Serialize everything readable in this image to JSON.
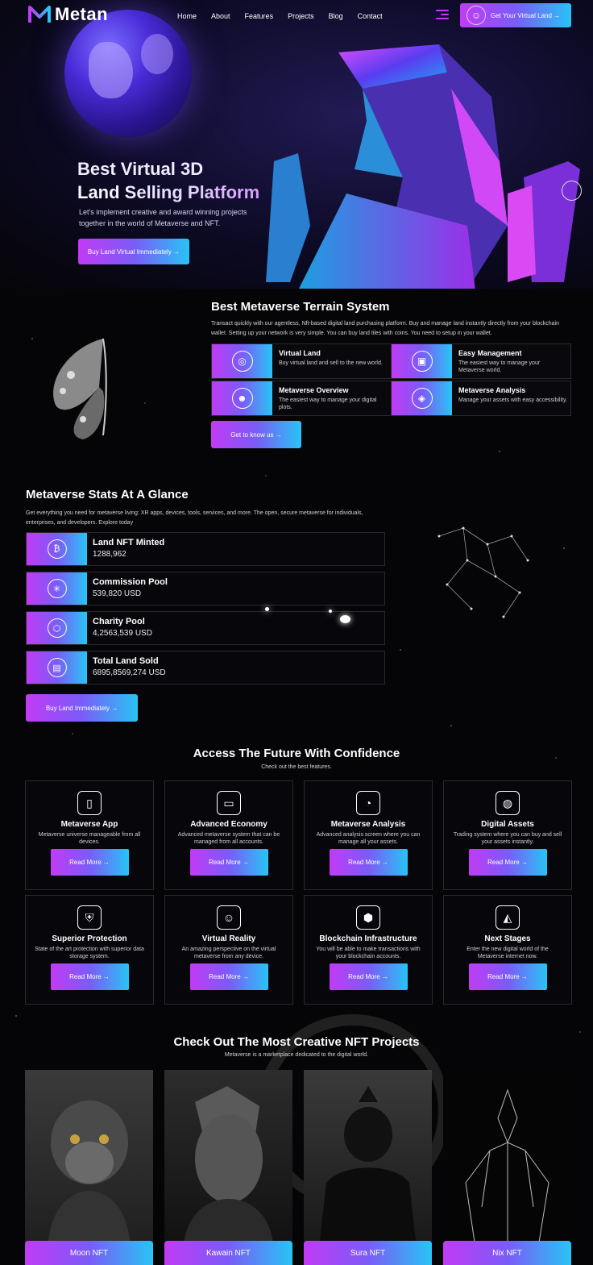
{
  "header": {
    "logo_text": "Metan",
    "nav": [
      "Home",
      "About",
      "Features",
      "Projects",
      "Blog",
      "Contact"
    ],
    "cta_label": "Get Your Virtual Land →"
  },
  "hero": {
    "title_line1": "Best Virtual 3D",
    "title_line2": "Land Selling Platform",
    "subtitle": "Let's implement creative and award winning projects together in the world of Metaverse and NFT.",
    "button_label": "Buy Land Virtual Immediately →"
  },
  "terrain": {
    "title": "Best Metaverse Terrain System",
    "description": "Transact quickly with our agentless, Nft-based digital land purchasing platform. Buy and manage land instantly directly from your blockchain wallet. Setting up your network is very simple. You can buy land tiles with coins. You need to setup in your wallet.",
    "features": [
      {
        "title": "Virtual Land",
        "desc": "Buy virtual land and sell to the new world.",
        "icon": "vr-headset-icon"
      },
      {
        "title": "Easy Management",
        "desc": "The easiest way to manage your Metaverse world.",
        "icon": "dashboard-icon"
      },
      {
        "title": "Metaverse Overview",
        "desc": "The easiest way to manage your digital plots.",
        "icon": "avatar-icon"
      },
      {
        "title": "Metaverse Analysis",
        "desc": "Manage your assets with easy accessibility.",
        "icon": "analytics-icon"
      }
    ],
    "button_label": "Get to know us →"
  },
  "stats": {
    "title": "Metaverse Stats At A Glance",
    "description": "Get everything you need for metaverse living: XR apps, devices, tools, services, and more. The open, secure metaverse for individuals, enterprises, and developers. Explore today",
    "items": [
      {
        "title": "Land NFT Minted",
        "value": "1288,962",
        "icon": "bitcoin-network-icon"
      },
      {
        "title": "Commission Pool",
        "value": "539,820 USD",
        "icon": "network-globe-icon"
      },
      {
        "title": "Charity Pool",
        "value": "4,2563,539 USD",
        "icon": "blocks-icon"
      },
      {
        "title": "Total Land Sold",
        "value": "6895,8569,274 USD",
        "icon": "growth-chart-icon"
      }
    ],
    "button_label": "Buy Land Immediately →"
  },
  "access": {
    "title": "Access The Future With Confidence",
    "subtitle": "Check out the best features.",
    "cards": [
      {
        "title": "Metaverse App",
        "desc": "Metaverse universe manageable from all devices.",
        "button": "Read More →",
        "icon": "phone-app-icon"
      },
      {
        "title": "Advanced Economy",
        "desc": "Advanced metaverse system that can be managed from all accounts.",
        "button": "Read More →",
        "icon": "monitor-cube-icon"
      },
      {
        "title": "Metaverse Analysis",
        "desc": "Advanced analysis screen where you can manage all your assets.",
        "button": "Read More →",
        "icon": "analysis-icon"
      },
      {
        "title": "Digital Assets",
        "desc": "Trading system where you can buy and sell your assets instantly.",
        "button": "Read More →",
        "icon": "globe-hand-icon"
      },
      {
        "title": "Superior Protection",
        "desc": "State of the art protection with superior data storage system.",
        "button": "Read More →",
        "icon": "laptop-shield-icon"
      },
      {
        "title": "Virtual Reality",
        "desc": "An amazing perspective on the virtual metaverse from any device.",
        "button": "Read More →",
        "icon": "vr-person-icon"
      },
      {
        "title": "Blockchain Infrastructure",
        "desc": "You will be able to make transactions with your blockchain accounts.",
        "button": "Read More →",
        "icon": "blockchain-icon"
      },
      {
        "title": "Next Stages",
        "desc": "Enter the new digital world of the Metaverse internet now.",
        "button": "Read More →",
        "icon": "pedestal-icon"
      }
    ]
  },
  "nft": {
    "title": "Check Out The Most Creative NFT Projects",
    "subtitle": "Metaverse is a marketplace dedicated to the digital world.",
    "items": [
      {
        "name": "Moon NFT"
      },
      {
        "name": "Kawain NFT"
      },
      {
        "name": "Sura NFT"
      },
      {
        "name": "Nix NFT"
      }
    ]
  },
  "colors": {
    "accent_start": "#c13bf5",
    "accent_end": "#28c4f5",
    "background": "#050507"
  }
}
